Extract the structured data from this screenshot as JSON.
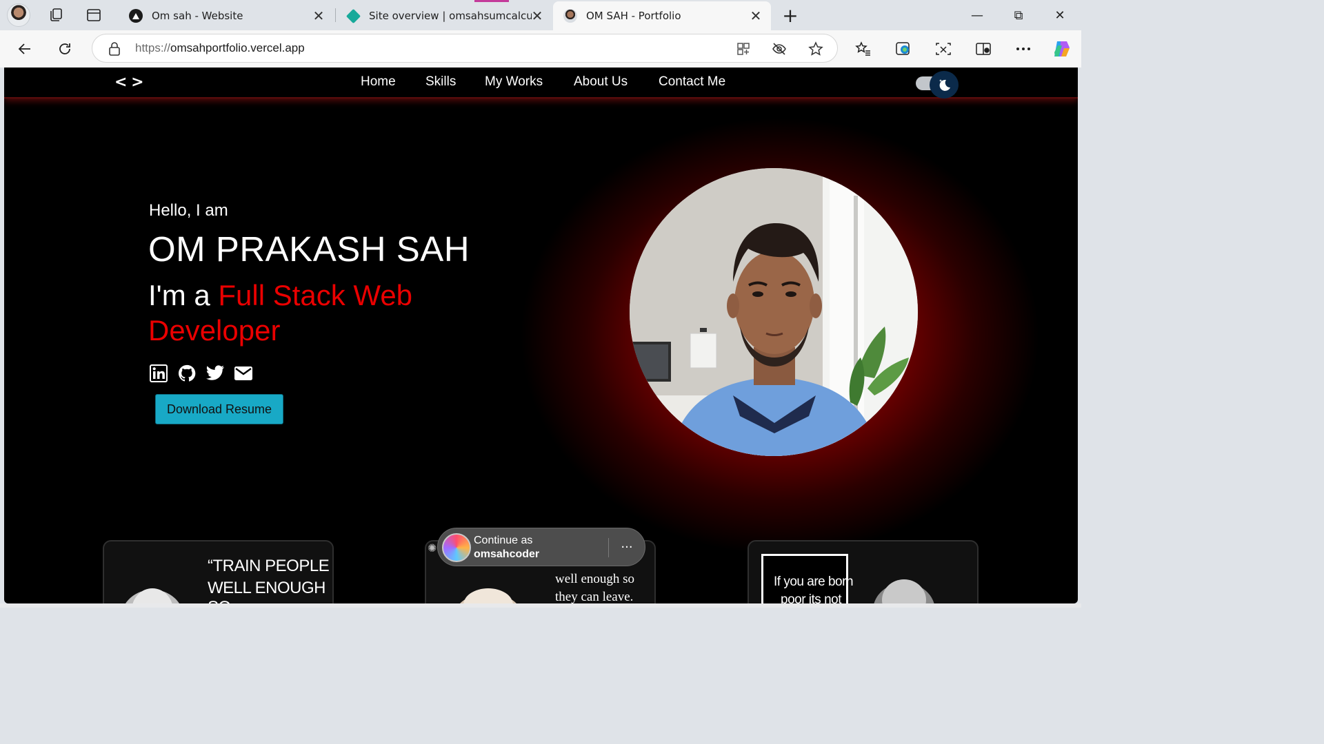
{
  "browser": {
    "tabs": [
      {
        "title": "Om sah - Website",
        "active": false
      },
      {
        "title": "Site overview | omsahsumcalculat",
        "active": false
      },
      {
        "title": "OM SAH - Portfolio",
        "active": true
      }
    ],
    "url_scheme": "https://",
    "url_host": "omsahportfolio.vercel.app",
    "new_tab_glyph": "+",
    "close_glyph": "✕",
    "minimize_glyph": "—",
    "restore_glyph": "⧉",
    "window_close_glyph": "✕"
  },
  "site": {
    "logo": "< >",
    "nav": [
      "Home",
      "Skills",
      "My Works",
      "About Us",
      "Contact Me"
    ],
    "hero": {
      "greeting": "Hello, I am",
      "name": "OM PRAKASH SAH",
      "role_prefix": "I'm a ",
      "role_accent": "Full Stack Web Developer",
      "resume_button": "Download Resume"
    },
    "socials": [
      "linkedin-icon",
      "github-icon",
      "twitter-icon",
      "mail-icon"
    ],
    "quote_cards": [
      {
        "text_line1": "“TRAIN PEOPLE",
        "text_line2": "WELL ENOUGH SO"
      },
      {
        "text_line1": "well enough so",
        "text_line2": "they can leave."
      },
      {
        "text_line1": "If you are born",
        "text_line2": "poor its not"
      }
    ]
  },
  "signin_popup": {
    "line1": "Continue as",
    "line2": "omsahcoder",
    "more": "···"
  },
  "colors": {
    "accent_red": "#ea0000",
    "button_cyan": "#18a9c6",
    "glow_red": "#b00000"
  }
}
